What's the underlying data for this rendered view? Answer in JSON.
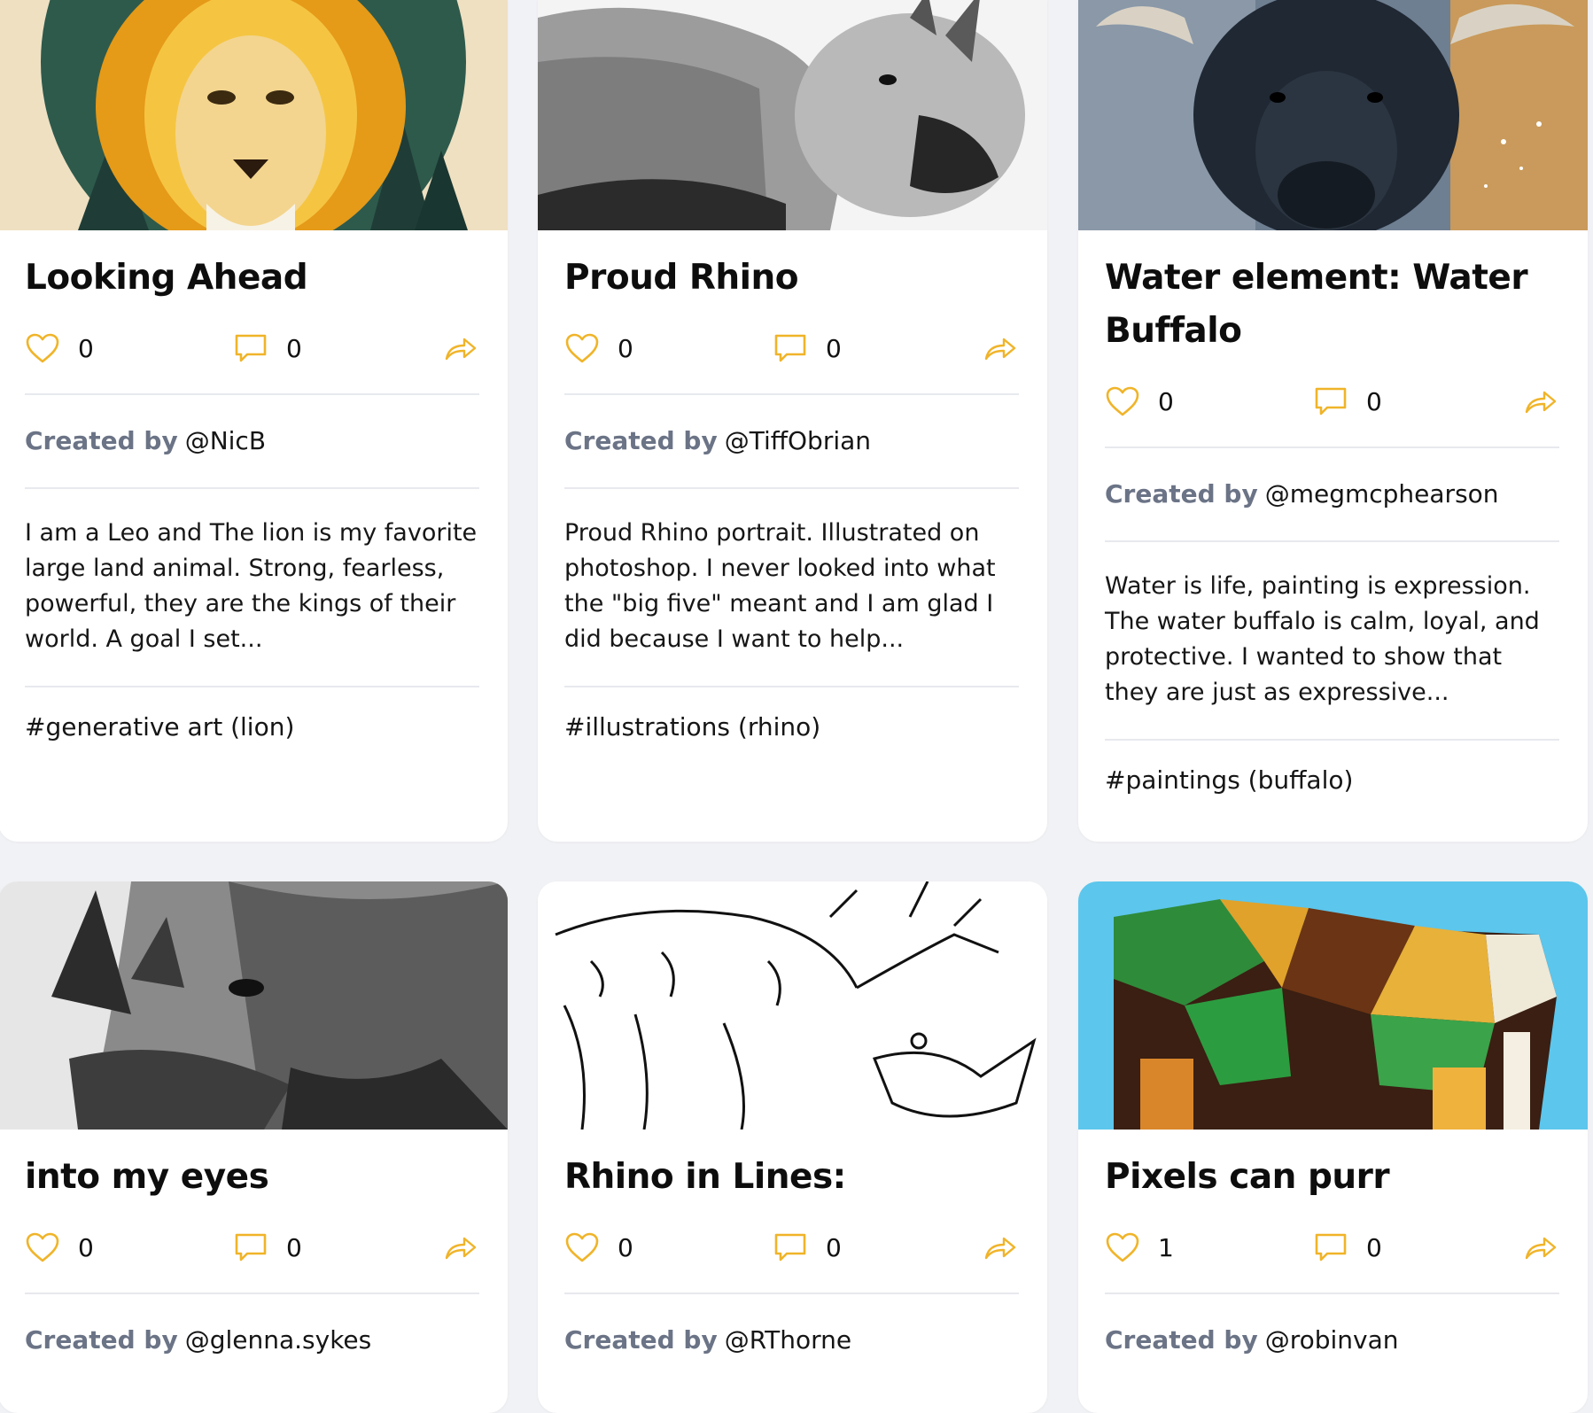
{
  "colors": {
    "accent": "#f0b429",
    "label": "#6b7486",
    "background": "#f1f2f5"
  },
  "icons": {
    "like": "heart-icon",
    "comment": "speech-bubble-icon",
    "share": "share-arrow-icon"
  },
  "creator_label": "Created by",
  "cards": [
    {
      "title": "Looking Ahead",
      "likes": "0",
      "comments": "0",
      "creator": "@NicB",
      "description": "I am a Leo and The lion is my favorite large land animal. Strong, fearless, powerful, they are the kings of their world. A goal I set...",
      "tag": "#generative art (lion)"
    },
    {
      "title": "Proud Rhino",
      "likes": "0",
      "comments": "0",
      "creator": "@TiffObrian",
      "description": "Proud Rhino portrait. Illustrated on photoshop. I never looked into what the \"big five\" meant and I am glad I did because I want to help...",
      "tag": "#illustrations (rhino)"
    },
    {
      "title": "Water element: Water Buffalo",
      "likes": "0",
      "comments": "0",
      "creator": "@megmcphearson",
      "description": "Water is life, painting is expression. The water buffalo is calm, loyal, and protective. I wanted to show that they are just as expressive...",
      "tag": "#paintings (buffalo)"
    },
    {
      "title": "into my eyes",
      "likes": "0",
      "comments": "0",
      "creator": "@glenna.sykes"
    },
    {
      "title": "Rhino in Lines:",
      "likes": "0",
      "comments": "0",
      "creator": "@RThorne"
    },
    {
      "title": "Pixels can purr",
      "likes": "1",
      "comments": "0",
      "creator": "@robinvan"
    }
  ]
}
